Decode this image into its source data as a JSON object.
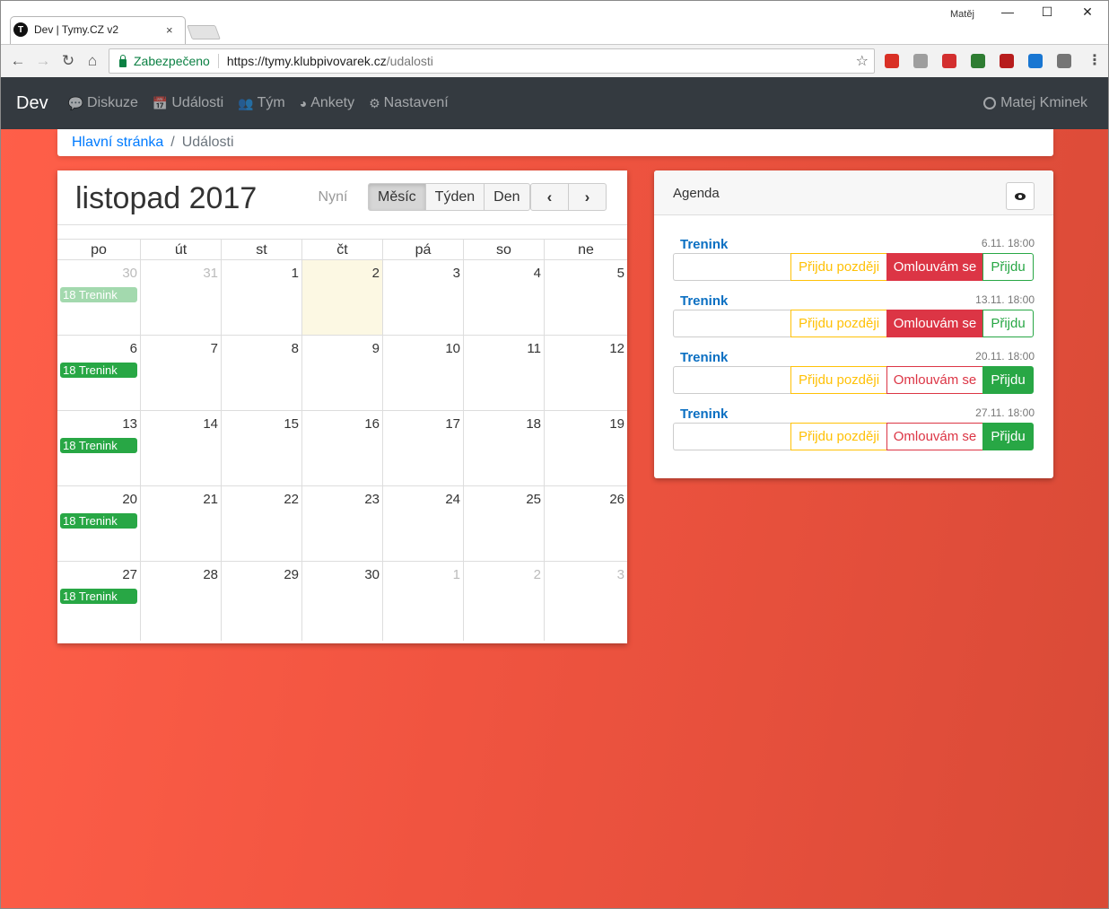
{
  "browser": {
    "tab_title": "Dev | Tymy.CZ v2",
    "tab_favicon": "T",
    "tab_close": "×",
    "window_user": "Matěj",
    "win_min": "—",
    "win_max": "☐",
    "win_close": "✕",
    "nav_back": "←",
    "nav_forward": "→",
    "nav_reload": "↻",
    "nav_home": "⌂",
    "secure_label": "Zabezpečeno",
    "url_host": "https://tymy.klubpivovarek.cz",
    "url_path": "/udalosti",
    "bookmark_star": "☆",
    "menu_dots": "⋮",
    "extensions": [
      "gmail-icon",
      "send-icon",
      "media-icon",
      "whatsapp-icon",
      "ublock-icon",
      "pocket-icon",
      "extension-icon"
    ],
    "extension_colors": [
      "#d93025",
      "#9e9e9e",
      "#d32f2f",
      "#2e7d32",
      "#b71c1c",
      "#1976d2",
      "#757575"
    ]
  },
  "navbar": {
    "brand": "Dev",
    "items": [
      {
        "label": "Diskuze",
        "icon": "comments-icon",
        "glyph": "💬"
      },
      {
        "label": "Události",
        "icon": "calendar-icon",
        "glyph": "📅"
      },
      {
        "label": "Tým",
        "icon": "users-icon",
        "glyph": "👥"
      },
      {
        "label": "Ankety",
        "icon": "pie-chart-icon",
        "glyph": "◕"
      },
      {
        "label": "Nastavení",
        "icon": "cogs-icon",
        "glyph": "⚙"
      }
    ],
    "user": "Matej Kminek"
  },
  "breadcrumb": {
    "home": "Hlavní stránka",
    "separator": "/",
    "current": "Události"
  },
  "calendar": {
    "title": "listopad 2017",
    "now_label": "Nyní",
    "views": [
      "Měsíc",
      "Týden",
      "Den"
    ],
    "active_view": "Měsíc",
    "prev": "‹",
    "next": "›",
    "weekdays": [
      "po",
      "út",
      "st",
      "čt",
      "pá",
      "so",
      "ne"
    ],
    "weeks": [
      [
        {
          "d": "30",
          "other": true,
          "event": "18 Trenink",
          "past": true
        },
        {
          "d": "31",
          "other": true
        },
        {
          "d": "1"
        },
        {
          "d": "2",
          "today": true
        },
        {
          "d": "3"
        },
        {
          "d": "4"
        },
        {
          "d": "5"
        }
      ],
      [
        {
          "d": "6",
          "event": "18 Trenink"
        },
        {
          "d": "7"
        },
        {
          "d": "8"
        },
        {
          "d": "9"
        },
        {
          "d": "10"
        },
        {
          "d": "11"
        },
        {
          "d": "12"
        }
      ],
      [
        {
          "d": "13",
          "event": "18 Trenink"
        },
        {
          "d": "14"
        },
        {
          "d": "15"
        },
        {
          "d": "16"
        },
        {
          "d": "17"
        },
        {
          "d": "18"
        },
        {
          "d": "19"
        }
      ],
      [
        {
          "d": "20",
          "event": "18 Trenink"
        },
        {
          "d": "21"
        },
        {
          "d": "22"
        },
        {
          "d": "23"
        },
        {
          "d": "24"
        },
        {
          "d": "25"
        },
        {
          "d": "26"
        }
      ],
      [
        {
          "d": "27",
          "event": "18 Trenink"
        },
        {
          "d": "28"
        },
        {
          "d": "29"
        },
        {
          "d": "30"
        },
        {
          "d": "1",
          "other": true
        },
        {
          "d": "2",
          "other": true
        },
        {
          "d": "3",
          "other": true
        }
      ]
    ]
  },
  "agenda": {
    "title": "Agenda",
    "items": [
      {
        "title": "Trenink",
        "date": "6.11. 18:00",
        "late": "Přijdu později",
        "excuse": "Omlouvám se",
        "yes": "Přijdu",
        "selected": "excuse"
      },
      {
        "title": "Trenink",
        "date": "13.11. 18:00",
        "late": "Přijdu později",
        "excuse": "Omlouvám se",
        "yes": "Přijdu",
        "selected": "excuse"
      },
      {
        "title": "Trenink",
        "date": "20.11. 18:00",
        "late": "Přijdu později",
        "excuse": "Omlouvám se",
        "yes": "Přijdu",
        "selected": "yes"
      },
      {
        "title": "Trenink",
        "date": "27.11. 18:00",
        "late": "Přijdu později",
        "excuse": "Omlouvám se",
        "yes": "Přijdu",
        "selected": "yes"
      }
    ]
  }
}
